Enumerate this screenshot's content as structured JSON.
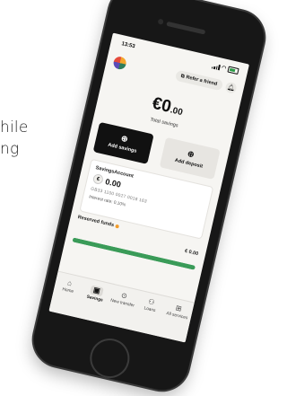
{
  "background_text": [
    "hile",
    "ng"
  ],
  "status_bar": {
    "time": "13:53"
  },
  "header": {
    "refer_label": "Refer a friend"
  },
  "balance": {
    "amount": "€0",
    "cents": ".00",
    "label": "Total savings"
  },
  "actions": [
    {
      "label": "Add savings",
      "icon": "plus-icon"
    },
    {
      "label": "Add deposit",
      "icon": "deposit-icon"
    }
  ],
  "savings_account": {
    "title": "SavingsAccount",
    "amount": "0.00",
    "iban": "GB33 1100 0027 0018 163",
    "rate": "Interest rate: 0.10%"
  },
  "reserved_funds": {
    "label": "Reserved funds",
    "value": "€ 0.00",
    "progress_fraction": 1.0
  },
  "nav": [
    {
      "label": "Home",
      "icon": "home-icon"
    },
    {
      "label": "Savings",
      "icon": "savings-icon"
    },
    {
      "label": "New transfer",
      "icon": "transfer-icon"
    },
    {
      "label": "Loans",
      "icon": "loans-icon"
    },
    {
      "label": "All services",
      "icon": "grid-icon"
    }
  ],
  "colors": {
    "accent_green": "#3a9b58",
    "dark_tile": "#111111",
    "light_tile": "#e7e5e1"
  }
}
